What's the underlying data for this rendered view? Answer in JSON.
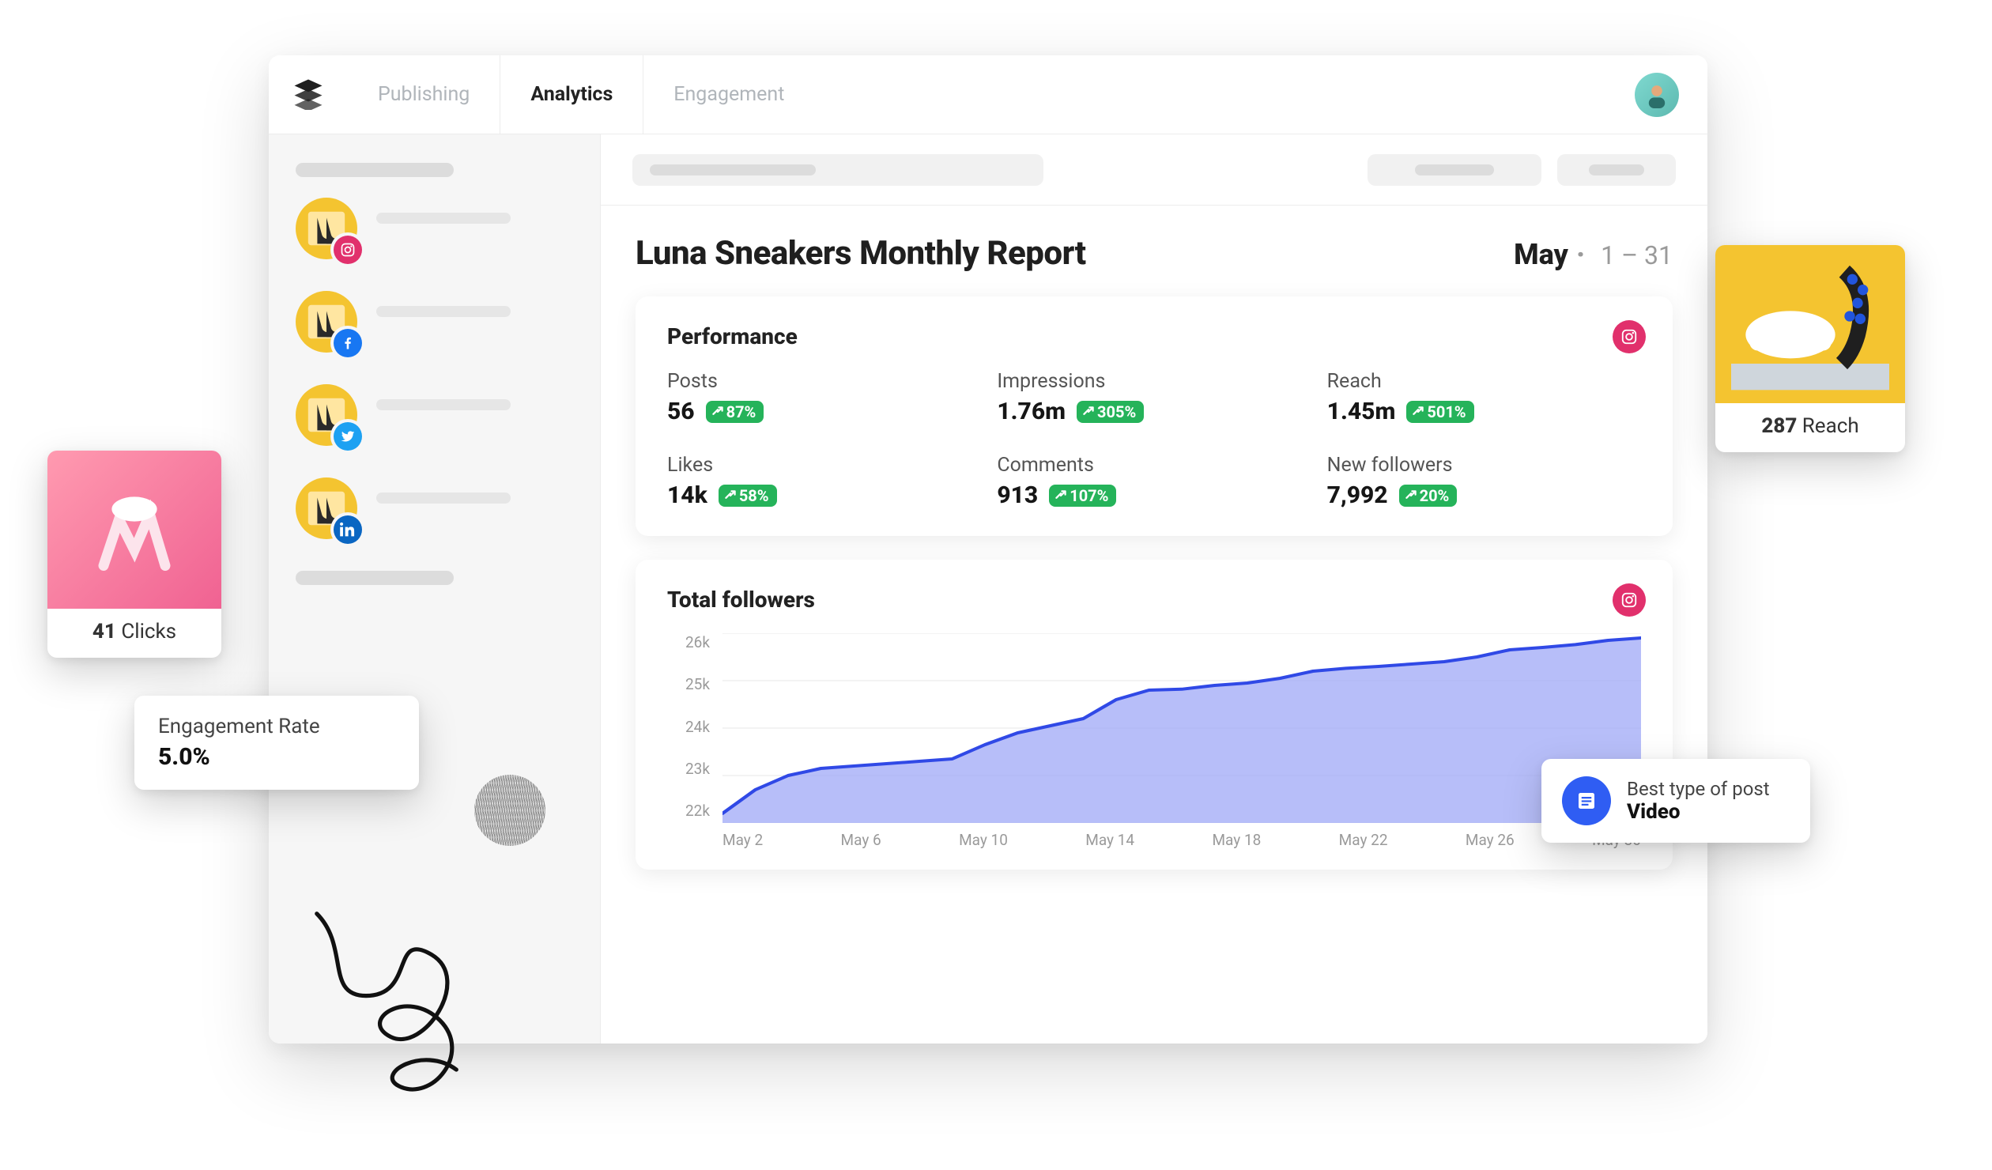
{
  "nav": {
    "tabs": [
      {
        "label": "Publishing",
        "active": false
      },
      {
        "label": "Analytics",
        "active": true
      },
      {
        "label": "Engagement",
        "active": false
      }
    ]
  },
  "sidebar": {
    "accounts": [
      {
        "network": "instagram"
      },
      {
        "network": "facebook"
      },
      {
        "network": "twitter"
      },
      {
        "network": "linkedin"
      }
    ]
  },
  "page": {
    "title": "Luna Sneakers Monthly Report",
    "month": "May",
    "range": "1 – 31"
  },
  "performance": {
    "title": "Performance",
    "source_network": "instagram",
    "metrics": [
      {
        "key": "posts",
        "label": "Posts",
        "value": "56",
        "delta": "87%"
      },
      {
        "key": "impressions",
        "label": "Impressions",
        "value": "1.76m",
        "delta": "305%"
      },
      {
        "key": "reach",
        "label": "Reach",
        "value": "1.45m",
        "delta": "501%"
      },
      {
        "key": "likes",
        "label": "Likes",
        "value": "14k",
        "delta": "58%"
      },
      {
        "key": "comments",
        "label": "Comments",
        "value": "913",
        "delta": "107%"
      },
      {
        "key": "newfollowers",
        "label": "New followers",
        "value": "7,992",
        "delta": "20%"
      }
    ]
  },
  "followers_chart": {
    "title": "Total followers",
    "source_network": "instagram"
  },
  "chart_data": {
    "type": "area",
    "title": "Total followers",
    "xlabel": "",
    "ylabel": "",
    "ylim": [
      22000,
      26000
    ],
    "y_ticks": [
      "26k",
      "25k",
      "24k",
      "23k",
      "22k"
    ],
    "x_ticks": [
      "May 2",
      "May 6",
      "May 10",
      "May 14",
      "May 18",
      "May 22",
      "May 26",
      "May 30"
    ],
    "x": [
      2,
      3,
      4,
      5,
      6,
      7,
      8,
      9,
      10,
      11,
      12,
      13,
      14,
      15,
      16,
      17,
      18,
      19,
      20,
      21,
      22,
      23,
      24,
      25,
      26,
      27,
      28,
      29,
      30
    ],
    "y": [
      22200,
      22700,
      23000,
      23150,
      23200,
      23250,
      23300,
      23350,
      23650,
      23900,
      24050,
      24200,
      24600,
      24800,
      24820,
      24900,
      24950,
      25050,
      25200,
      25260,
      25300,
      25350,
      25400,
      25500,
      25650,
      25700,
      25760,
      25850,
      25900
    ]
  },
  "callouts": {
    "clicks": {
      "value": "41",
      "label": "Clicks"
    },
    "reach": {
      "value": "287",
      "label": "Reach"
    },
    "engagement": {
      "label": "Engagement Rate",
      "value": "5.0%"
    },
    "best_type": {
      "label": "Best type of post",
      "value": "Video"
    }
  }
}
